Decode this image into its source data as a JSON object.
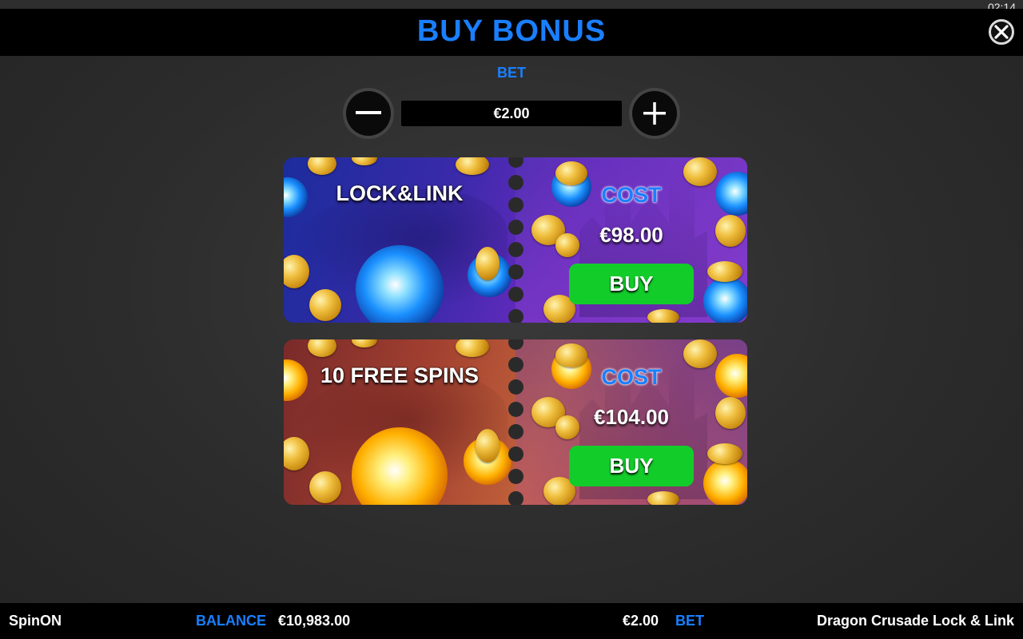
{
  "status": {
    "time": "02:14"
  },
  "header": {
    "title": "BUY BONUS"
  },
  "bet": {
    "label": "BET",
    "value": "€2.00"
  },
  "bonuses": [
    {
      "name": "LOCK&LINK",
      "cost_label": "COST",
      "cost": "€98.00",
      "buy_label": "BUY",
      "orb_color": "#1a90ff"
    },
    {
      "name": "10 FREE SPINS",
      "cost_label": "COST",
      "cost": "€104.00",
      "buy_label": "BUY",
      "orb_color": "#ffb000"
    }
  ],
  "footer": {
    "brand": "SpinON",
    "balance_label": "BALANCE",
    "balance_value": "€10,983.00",
    "bet_value": "€2.00",
    "bet_label": "BET",
    "game_title": "Dragon Crusade Lock & Link"
  },
  "colors": {
    "accent": "#1a7fff",
    "buy_button": "#12cc2a",
    "header_bg": "#000000"
  },
  "icons": {
    "close": "close-icon",
    "minus": "minus-icon",
    "plus": "plus-icon"
  }
}
